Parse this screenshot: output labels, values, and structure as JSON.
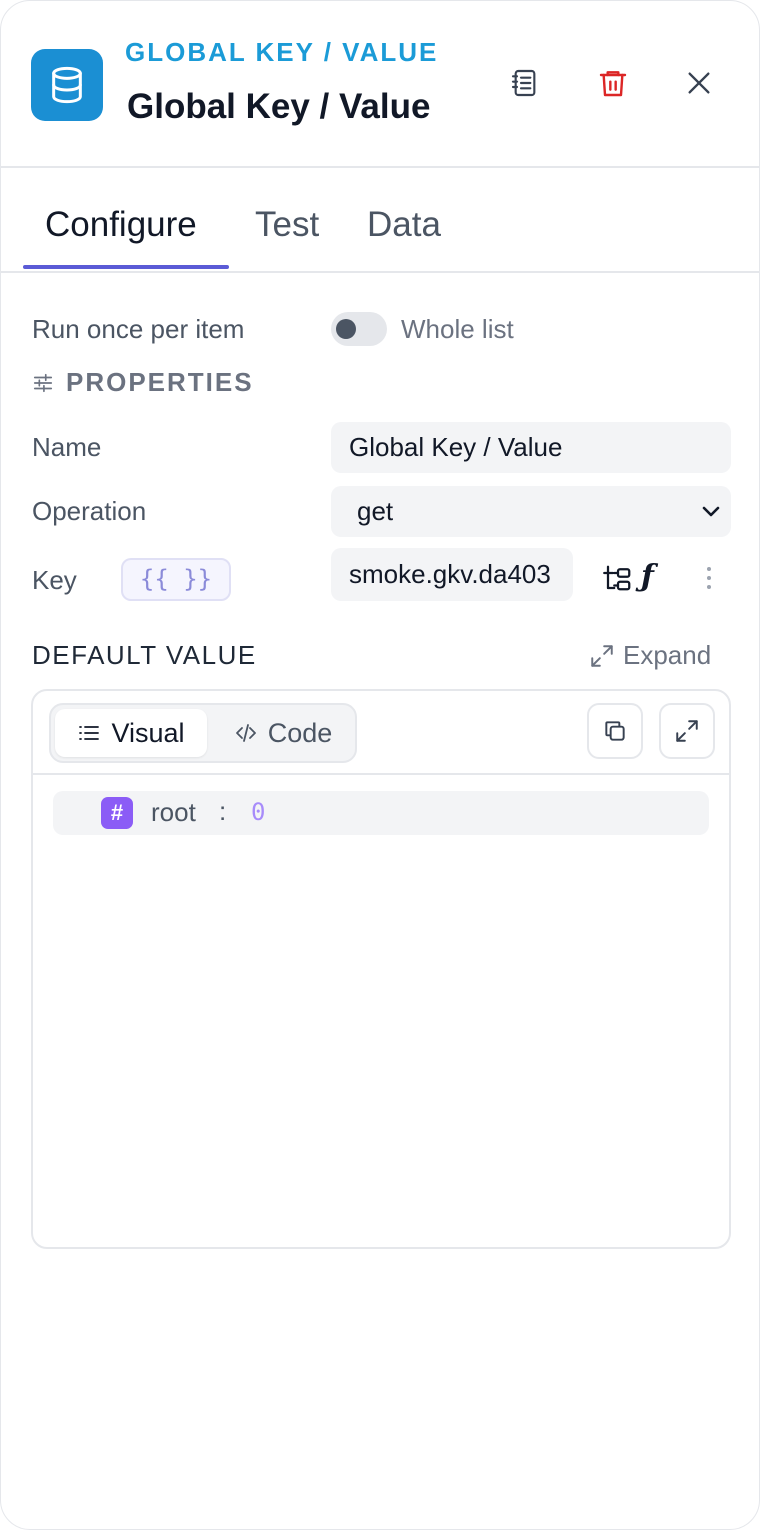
{
  "header": {
    "eyebrow": "GLOBAL KEY / VALUE",
    "title": "Global Key / Value",
    "app_icon": "database-icon",
    "actions": [
      {
        "icon": "notes-icon"
      },
      {
        "icon": "trash-icon",
        "color": "#dc2626"
      },
      {
        "icon": "close-icon"
      }
    ],
    "accent_color": "#1b9bd7"
  },
  "tabs": [
    {
      "label": "Configure",
      "active": true
    },
    {
      "label": "Test",
      "active": false
    },
    {
      "label": "Data",
      "active": false
    }
  ],
  "tab_accent_color": "#5b5bd6",
  "run_mode": {
    "label": "Run once per item",
    "toggle_label": "Whole list",
    "toggle_on": false
  },
  "properties": {
    "heading": "PROPERTIES",
    "name": {
      "label": "Name",
      "value": "Global Key / Value"
    },
    "operation": {
      "label": "Operation",
      "value": "get"
    },
    "key": {
      "label": "Key",
      "template_badge": "{{ }}",
      "value": "smoke.gkv.da403"
    }
  },
  "default_value": {
    "heading": "DEFAULT VALUE",
    "expand_label": "Expand",
    "modes": {
      "visual": "Visual",
      "code": "Code",
      "active": "visual"
    },
    "root": {
      "type_badge": "#",
      "key": "root",
      "separator": ":",
      "value": "0",
      "value_color": "#a78bfa"
    }
  }
}
